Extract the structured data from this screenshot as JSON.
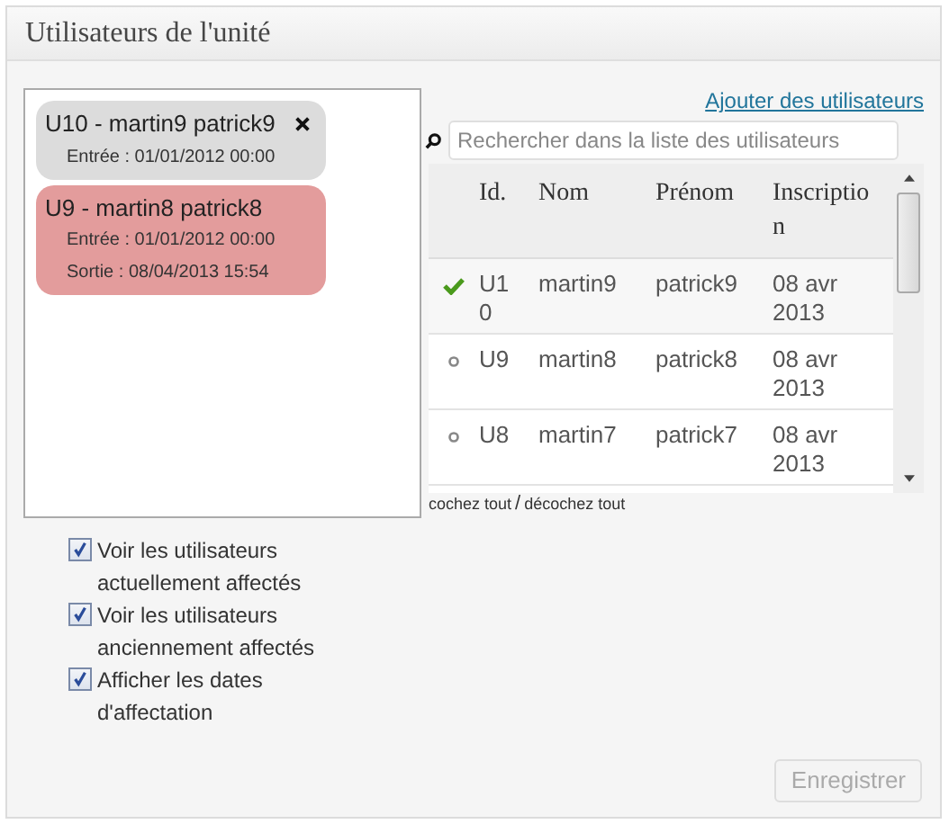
{
  "panel": {
    "title": "Utilisateurs de l'unité"
  },
  "assigned": [
    {
      "label": "U10 - martin9 patrick9",
      "kind": "current",
      "removable": true,
      "dates": [
        "Entrée : 01/01/2012 00:00"
      ]
    },
    {
      "label": "U9 - martin8 patrick8",
      "kind": "former",
      "removable": false,
      "dates": [
        "Entrée : 01/01/2012 00:00",
        "Sortie : 08/04/2013 15:54"
      ]
    }
  ],
  "add_link": "Ajouter des utilisateurs",
  "search": {
    "placeholder": "Rechercher dans la liste des utilisateurs"
  },
  "table": {
    "columns": [
      "Id.",
      "Nom",
      "Prénom",
      "Inscription"
    ],
    "rows": [
      {
        "selected": true,
        "cells": [
          "U10",
          "martin9",
          "patrick9",
          "08 avr 2013"
        ]
      },
      {
        "selected": false,
        "cells": [
          "U9",
          "martin8",
          "patrick8",
          "08 avr 2013"
        ]
      },
      {
        "selected": false,
        "cells": [
          "U8",
          "martin7",
          "patrick7",
          "08 avr 2013"
        ]
      }
    ]
  },
  "check_all": "cochez tout",
  "separator": "/",
  "uncheck_all": "décochez tout",
  "options": [
    {
      "label": "Voir les utilisateurs actuellement affectés",
      "checked": true
    },
    {
      "label": "Voir les utilisateurs anciennement affectés",
      "checked": true
    },
    {
      "label": "Afficher les dates d'affectation",
      "checked": true
    }
  ],
  "save_button": {
    "label": "Enregistrer",
    "disabled": true
  }
}
